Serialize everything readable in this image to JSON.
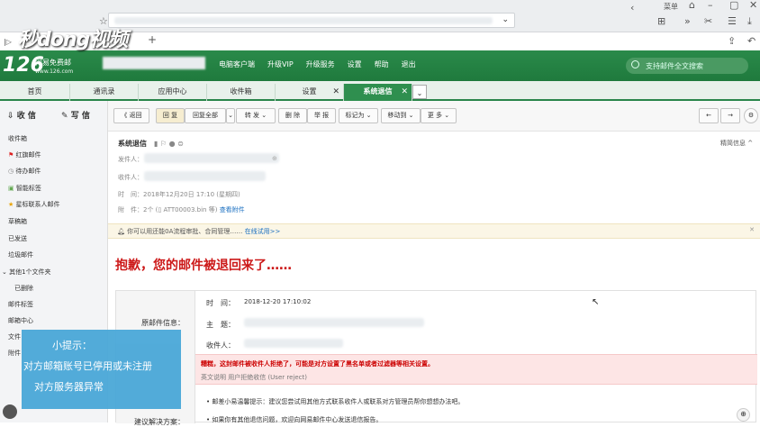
{
  "browser": {
    "menu_label": "菜单",
    "new_tab": "+"
  },
  "overlay": {
    "logo": "秒dong视频"
  },
  "brand": {
    "logo": "126",
    "name": "网易免费邮",
    "url": "www.126.com"
  },
  "topnav": [
    "电脑客户端",
    "升级VIP",
    "升级服务",
    "设置",
    "帮助",
    "退出"
  ],
  "search": {
    "placeholder": "支持邮件全文搜索"
  },
  "tabs": [
    "首页",
    "通讯录",
    "应用中心",
    "收件箱",
    "设置",
    "系统退信"
  ],
  "sidebar": {
    "receive": "收 信",
    "compose": "写 信",
    "items": [
      "收件箱",
      "红旗邮件",
      "待办邮件",
      "智能标签",
      "星标联系人邮件",
      "草稿箱",
      "已发送",
      "垃圾邮件",
      "其他1个文件夹",
      "已删除",
      "邮件标签",
      "邮箱中心",
      "文件",
      "附件"
    ]
  },
  "tip": {
    "title": "小提示：",
    "line1": "对方邮箱账号已停用或未注册",
    "line2": "对方服务器异常"
  },
  "toolbar": [
    "《 返回",
    "回 复",
    "回复全部",
    "转 发",
    "删 除",
    "举 报",
    "标记为",
    "移动到",
    "更 多"
  ],
  "message": {
    "subject": "系统退信",
    "sender_label": "发件人：",
    "recipient_label": "收件人：",
    "time": "时　间：2018年12月20日 17:10 (星期四)",
    "attachment": "附　件：2个 (",
    "attachment_file": "ATT00003.bin 等)",
    "view_attachment": "查看附件",
    "detail": "精简信息"
  },
  "promo": {
    "text": "你可以用还能0A流程审批、合同管理……",
    "link": "在线试用>>"
  },
  "bounce": {
    "headline": "抱歉，您的邮件被退回来了……",
    "orig_label": "原邮件信息：",
    "time_label": "时　间：",
    "time_value": "2018-12-20 17:10:02",
    "subject_label": "主　题：",
    "recipient_label": "收件人：",
    "reason": "糟糕，这封邮件被收件人拒绝了，可能是对方设置了黑名单或者过滤器等相关设置。",
    "reason_en": "英文说明 用户拒绝收信 (User reject)",
    "solution_label": "建议解决方案：",
    "tip1": "邮差小易温馨提示：建议您尝试用其他方式联系收件人或联系对方管理员帮你想想办法吧。",
    "tip2": "如果你有其他退信问题，欢迎向网易邮件中心发送退信报告。"
  }
}
